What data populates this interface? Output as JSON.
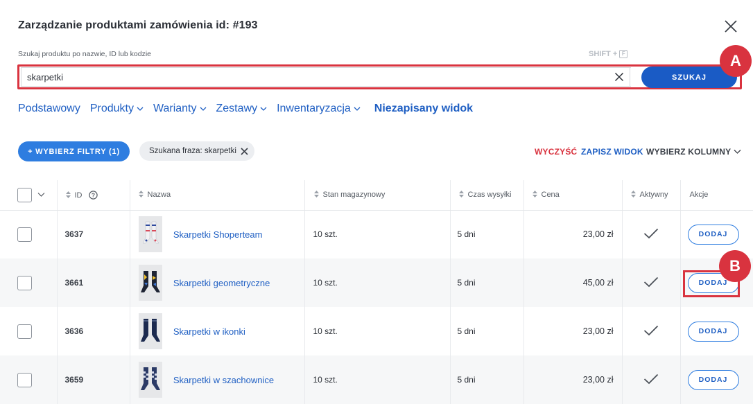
{
  "dialog": {
    "title": "Zarządzanie produktami zamówienia id: #193"
  },
  "search": {
    "label": "Szukaj produktu po nazwie, ID lub kodzie",
    "shortcut_prefix": "SHIFT +",
    "shortcut_key": "F",
    "value": "skarpetki",
    "button_label": "SZUKAJ"
  },
  "markers": {
    "a": "A",
    "b": "B"
  },
  "views": [
    {
      "label": "Podstawowy",
      "dropdown": false
    },
    {
      "label": "Produkty",
      "dropdown": true
    },
    {
      "label": "Warianty",
      "dropdown": true
    },
    {
      "label": "Zestawy",
      "dropdown": true
    },
    {
      "label": "Inwentaryzacja",
      "dropdown": true
    },
    {
      "label": "Niezapisany widok",
      "dropdown": false,
      "active": true
    }
  ],
  "filters": {
    "add_label": "+ WYBIERZ FILTRY (1)",
    "chip_label": "Szukana fraza: skarpetki"
  },
  "toolbar": {
    "clear_label": "WYCZYŚĆ",
    "save_view_label": "ZAPISZ WIDOK",
    "choose_columns_label": "WYBIERZ KOLUMNY"
  },
  "table": {
    "columns": {
      "id": "ID",
      "name": "Nazwa",
      "stock": "Stan magazynowy",
      "shipping": "Czas wysyłki",
      "price": "Cena",
      "active": "Aktywny",
      "actions": "Akcje"
    },
    "rows": [
      {
        "id": "3637",
        "name": "Skarpetki Shoperteam",
        "stock": "10 szt.",
        "shipping": "5 dni",
        "price": "23,00 zł",
        "active": true,
        "action": "DODAJ",
        "thumb": "socks-pattern-light"
      },
      {
        "id": "3661",
        "name": "Skarpetki geometryczne",
        "stock": "10 szt.",
        "shipping": "5 dni",
        "price": "45,00 zł",
        "active": true,
        "action": "DODAJ",
        "thumb": "socks-geometric-dark"
      },
      {
        "id": "3636",
        "name": "Skarpetki w ikonki",
        "stock": "10 szt.",
        "shipping": "5 dni",
        "price": "23,00 zł",
        "active": true,
        "action": "DODAJ",
        "thumb": "socks-navy"
      },
      {
        "id": "3659",
        "name": "Skarpetki w szachownice",
        "stock": "10 szt.",
        "shipping": "5 dni",
        "price": "23,00 zł",
        "active": true,
        "action": "DODAJ",
        "thumb": "socks-checkered"
      }
    ]
  },
  "colors": {
    "primary": "#1a5bc5",
    "accent_blue": "#2e7de0",
    "highlight_red": "#d9333f"
  }
}
